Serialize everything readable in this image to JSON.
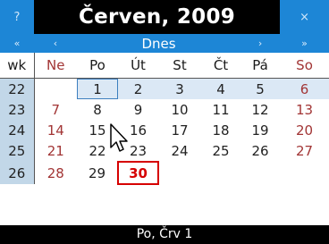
{
  "header": {
    "title": "Červen, 2009",
    "help_label": "?",
    "close_label": "×"
  },
  "nav": {
    "prev_year": "«",
    "prev_month": "‹",
    "today": "Dnes",
    "next_month": "›",
    "next_year": "»"
  },
  "day_names": {
    "wk": "wk",
    "d1": "Ne",
    "d2": "Po",
    "d3": "Út",
    "d4": "St",
    "d5": "Čt",
    "d6": "Pá",
    "d7": "So"
  },
  "weeks": [
    {
      "wk": "22",
      "d1": "",
      "d2": "1",
      "d3": "2",
      "d4": "3",
      "d5": "4",
      "d6": "5",
      "d7": "6"
    },
    {
      "wk": "23",
      "d1": "7",
      "d2": "8",
      "d3": "9",
      "d4": "10",
      "d5": "11",
      "d6": "12",
      "d7": "13"
    },
    {
      "wk": "24",
      "d1": "14",
      "d2": "15",
      "d3": "16",
      "d4": "17",
      "d5": "18",
      "d6": "19",
      "d7": "20"
    },
    {
      "wk": "25",
      "d1": "21",
      "d2": "22",
      "d3": "23",
      "d4": "24",
      "d5": "25",
      "d6": "26",
      "d7": "27"
    },
    {
      "wk": "26",
      "d1": "28",
      "d2": "29",
      "d3": "30",
      "d4": "",
      "d5": "",
      "d6": "",
      "d7": ""
    }
  ],
  "status": "Po, Črv 1",
  "colors": {
    "header_blue": "#1d86d6",
    "title_bg": "#000000",
    "weekend_text": "#a23535",
    "today_border": "#d60000",
    "week_col_bg": "#c2d7e8",
    "hover_row_bg": "#dbe8f5"
  },
  "icons": {
    "cursor": "mouse-pointer-icon"
  }
}
